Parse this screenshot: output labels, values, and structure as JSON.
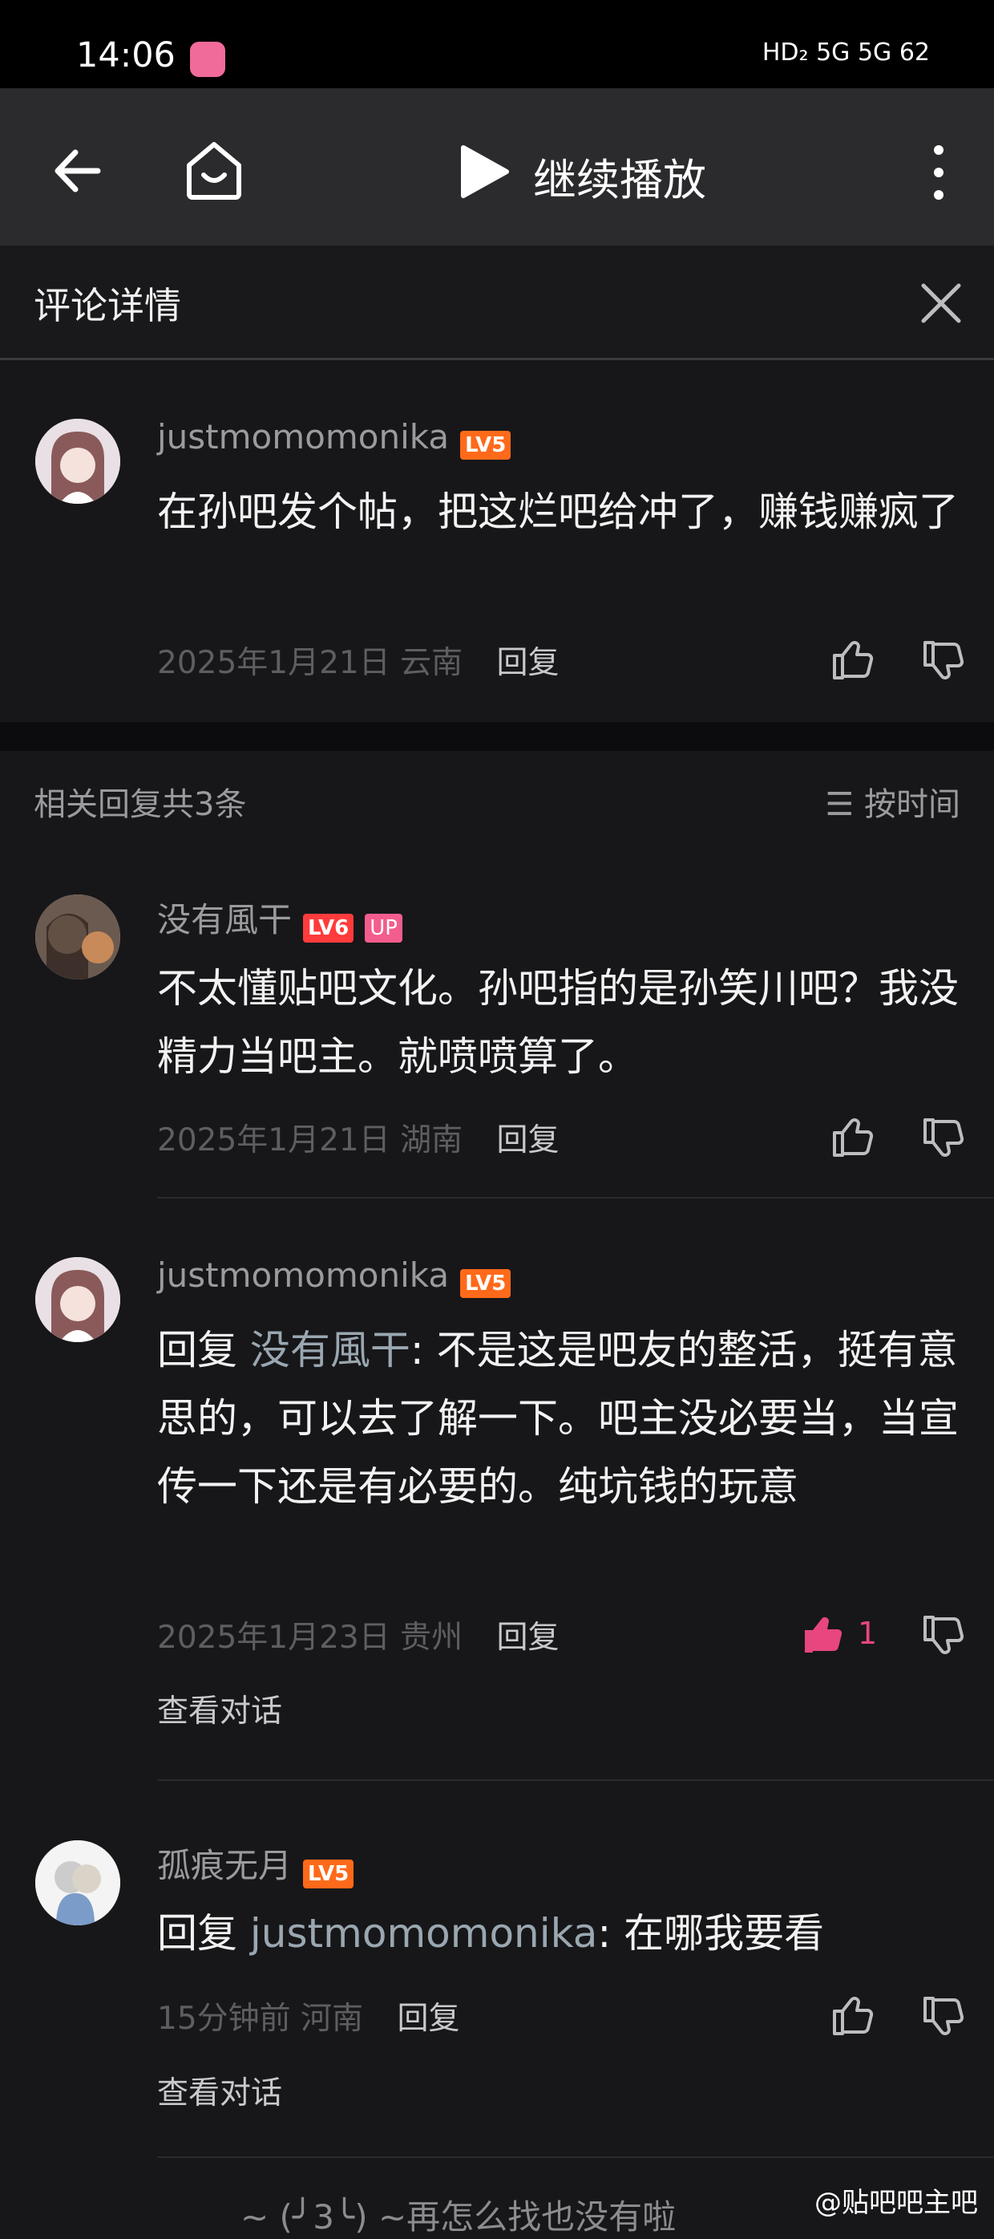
{
  "status_bar": {
    "time": "14:06",
    "icons_text": "HD₂ 5G 5G 62",
    "battery": "62"
  },
  "player_bar": {
    "continue_label": "继续播放"
  },
  "header": {
    "title": "评论详情"
  },
  "main_comment": {
    "username": "justmomomonika",
    "level": "LV5",
    "text": "在孙吧发个帖，把这烂吧给冲了，赚钱赚疯了",
    "date": "2025年1月21日",
    "location": "云南",
    "reply_label": "回复"
  },
  "replies_header": {
    "count_label": "相关回复共3条",
    "sort_label": "按时间"
  },
  "replies": [
    {
      "username": "没有風干",
      "level": "LV6",
      "badge": "UP",
      "prefix": "",
      "mention": "",
      "text": "不太懂贴吧文化。孙吧指的是孙笑川吧？我没精力当吧主。就喷喷算了。",
      "date": "2025年1月21日",
      "location": "湖南",
      "reply_label": "回复",
      "likes": ""
    },
    {
      "username": "justmomomonika",
      "level": "LV5",
      "badge": "",
      "prefix": "回复 ",
      "mention": "没有風干",
      "text": ": 不是这是吧友的整活，挺有意思的，可以去了解一下。吧主没必要当，当宣传一下还是有必要的。纯坑钱的玩意",
      "date": "2025年1月23日",
      "location": "贵州",
      "reply_label": "回复",
      "likes": "1",
      "view_conversation": "查看对话"
    },
    {
      "username": "孤痕无月",
      "level": "LV5",
      "badge": "",
      "prefix": "回复 ",
      "mention": "justmomomonika",
      "text": ": 在哪我要看",
      "date": "15分钟前",
      "location": "河南",
      "reply_label": "回复",
      "likes": "",
      "view_conversation": "查看对话"
    }
  ],
  "footer": {
    "text": "~ (╯3╰) ~再怎么找也没有啦",
    "watermark": "@贴吧吧主吧"
  },
  "colors": {
    "accent": "#f25d8e",
    "level": "#ff6a1a",
    "background": "#17171a"
  }
}
